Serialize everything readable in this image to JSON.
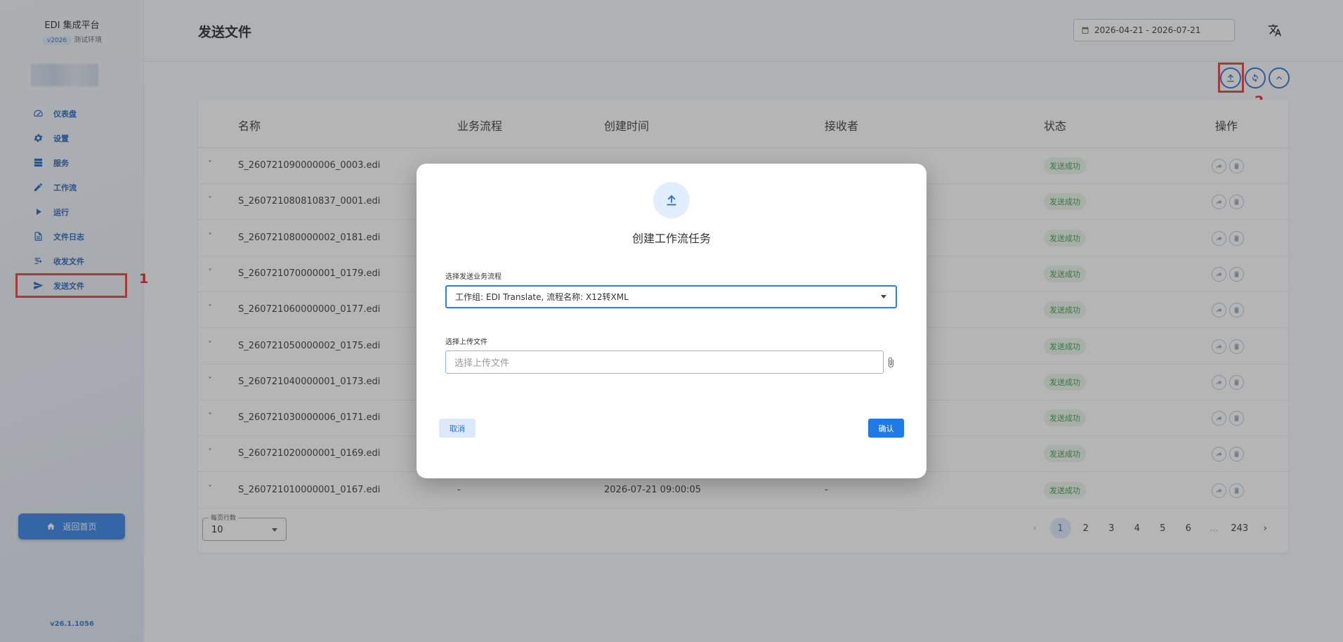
{
  "sidebar": {
    "brand": "EDI 集成平台",
    "version_chip": "v2026",
    "env": "测试环境",
    "items": [
      {
        "label": "仪表盘"
      },
      {
        "label": "设置"
      },
      {
        "label": "服务"
      },
      {
        "label": "工作流"
      },
      {
        "label": "运行"
      },
      {
        "label": "文件日志"
      },
      {
        "label": "收发文件"
      },
      {
        "label": "发送文件"
      }
    ],
    "home_button": "返回首页",
    "footer_version": "v26.1.1056"
  },
  "annotations": {
    "mark_1": "1",
    "mark_2": "2"
  },
  "header": {
    "title": "发送文件",
    "date_range": "2026-04-21 - 2026-07-21"
  },
  "table": {
    "columns": [
      "名称",
      "业务流程",
      "创建时间",
      "接收者",
      "状态",
      "操作"
    ],
    "rows": [
      {
        "name": "S_260721090000006_0003.edi",
        "flow": "",
        "created": "",
        "receiver": "",
        "status": "发送成功"
      },
      {
        "name": "S_260721080810837_0001.edi",
        "flow": "",
        "created": "",
        "receiver": "",
        "status": "发送成功"
      },
      {
        "name": "S_260721080000002_0181.edi",
        "flow": "",
        "created": "",
        "receiver": "",
        "status": "发送成功"
      },
      {
        "name": "S_260721070000001_0179.edi",
        "flow": "",
        "created": "",
        "receiver": "",
        "status": "发送成功"
      },
      {
        "name": "S_260721060000000_0177.edi",
        "flow": "",
        "created": "",
        "receiver": "",
        "status": "发送成功"
      },
      {
        "name": "S_260721050000002_0175.edi",
        "flow": "",
        "created": "",
        "receiver": "",
        "status": "发送成功"
      },
      {
        "name": "S_260721040000001_0173.edi",
        "flow": "",
        "created": "",
        "receiver": "",
        "status": "发送成功"
      },
      {
        "name": "S_260721030000006_0171.edi",
        "flow": "",
        "created": "",
        "receiver": "",
        "status": "发送成功"
      },
      {
        "name": "S_260721020000001_0169.edi",
        "flow": "",
        "created": "",
        "receiver": "",
        "status": "发送成功"
      },
      {
        "name": "S_260721010000001_0167.edi",
        "flow": "-",
        "created": "2026-07-21 09:00:05",
        "receiver": "-",
        "status": "发送成功"
      }
    ]
  },
  "pagination": {
    "rows_per_page_label": "每页行数",
    "rows_per_page": "10",
    "pages": [
      "1",
      "2",
      "3",
      "4",
      "5",
      "6",
      "...",
      "243"
    ],
    "current": "1"
  },
  "modal": {
    "title": "创建工作流任务",
    "flow_label": "选择发送业务流程",
    "flow_value": "工作组: EDI Translate, 流程名称: X12转XML",
    "file_label": "选择上传文件",
    "file_placeholder": "选择上传文件",
    "cancel": "取消",
    "confirm": "确认"
  },
  "colors": {
    "primary": "#2d6fd4",
    "success_bg": "#e8f6ea",
    "success_text": "#3a9a4a",
    "highlight": "#e23a3a"
  }
}
